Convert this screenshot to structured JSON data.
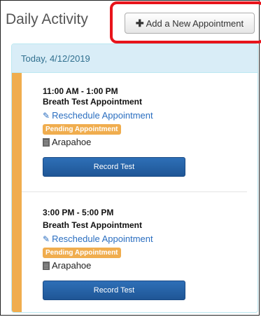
{
  "header": {
    "title": "Daily Activity",
    "add_button_label": "Add a New Appointment"
  },
  "panel": {
    "heading": "Today, 4/12/2019"
  },
  "appointments": [
    {
      "time": "11:00 AM - 1:00 PM",
      "name": "Breath Test Appointment",
      "reschedule_label": "Reschedule Appointment",
      "status_badge": "Pending Appointment",
      "location": "Arapahoe",
      "record_button_label": "Record Test"
    },
    {
      "time": "3:00 PM - 5:00 PM",
      "name": "Breath Test Appointment",
      "reschedule_label": "Reschedule Appointment",
      "status_badge": "Pending Appointment",
      "location": "Arapahoe",
      "record_button_label": "Record Test"
    }
  ],
  "colors": {
    "accent": "#f0ad4e",
    "panel_heading_bg": "#d9edf7",
    "link": "#2a6ec0",
    "primary_button": "#2e6fb7",
    "highlight": "#e8141b"
  },
  "icons": {
    "add": "plus-icon",
    "reschedule": "edit-icon",
    "location": "building-icon"
  }
}
